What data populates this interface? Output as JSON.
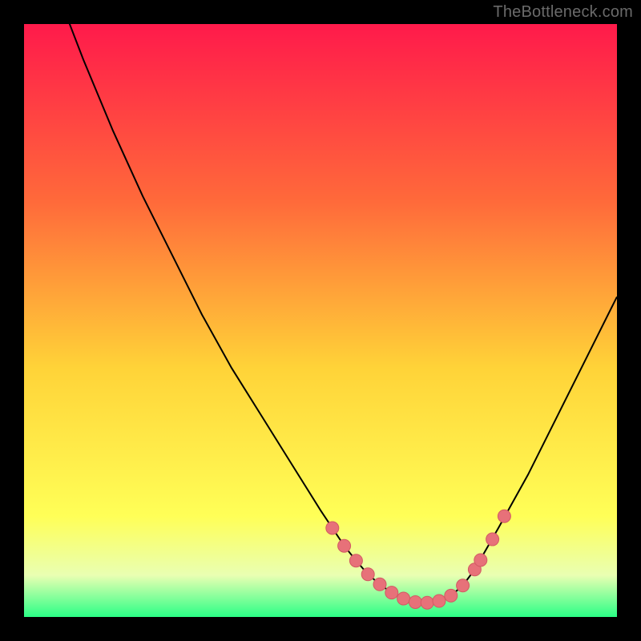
{
  "watermark": "TheBottleneck.com",
  "colors": {
    "frame": "#000000",
    "curve": "#000000",
    "marker_fill": "#e77179",
    "marker_stroke": "#d25a63",
    "grad_top": "#ff1a4b",
    "grad_mid1": "#ff6a3a",
    "grad_mid2": "#ffd338",
    "grad_mid3": "#ffff57",
    "grad_mid4": "#e9ffb2",
    "grad_bottom": "#2bff86"
  },
  "chart_data": {
    "type": "line",
    "title": "",
    "xlabel": "",
    "ylabel": "",
    "xlim": [
      0,
      100
    ],
    "ylim": [
      0,
      100
    ],
    "series": [
      {
        "name": "bottleneck-curve",
        "x": [
          0,
          5,
          10,
          15,
          20,
          25,
          30,
          35,
          40,
          45,
          50,
          52,
          54,
          56,
          58,
          60,
          62,
          64,
          66,
          68,
          70,
          72,
          74,
          76,
          80,
          85,
          90,
          95,
          100
        ],
        "values": [
          130,
          107,
          94,
          82,
          71,
          61,
          51,
          42,
          34,
          26,
          18,
          15,
          12,
          9.5,
          7.2,
          5.5,
          4.1,
          3.1,
          2.5,
          2.4,
          2.7,
          3.6,
          5.3,
          8,
          15,
          24,
          34,
          44,
          54
        ]
      }
    ],
    "markers": {
      "name": "highlighted-points",
      "x": [
        52,
        54,
        56,
        58,
        60,
        62,
        64,
        66,
        68,
        70,
        72,
        74,
        76,
        77,
        79,
        81
      ],
      "values": [
        15,
        12,
        9.5,
        7.2,
        5.5,
        4.1,
        3.1,
        2.5,
        2.4,
        2.7,
        3.6,
        5.3,
        8,
        9.6,
        13.1,
        17
      ]
    }
  }
}
